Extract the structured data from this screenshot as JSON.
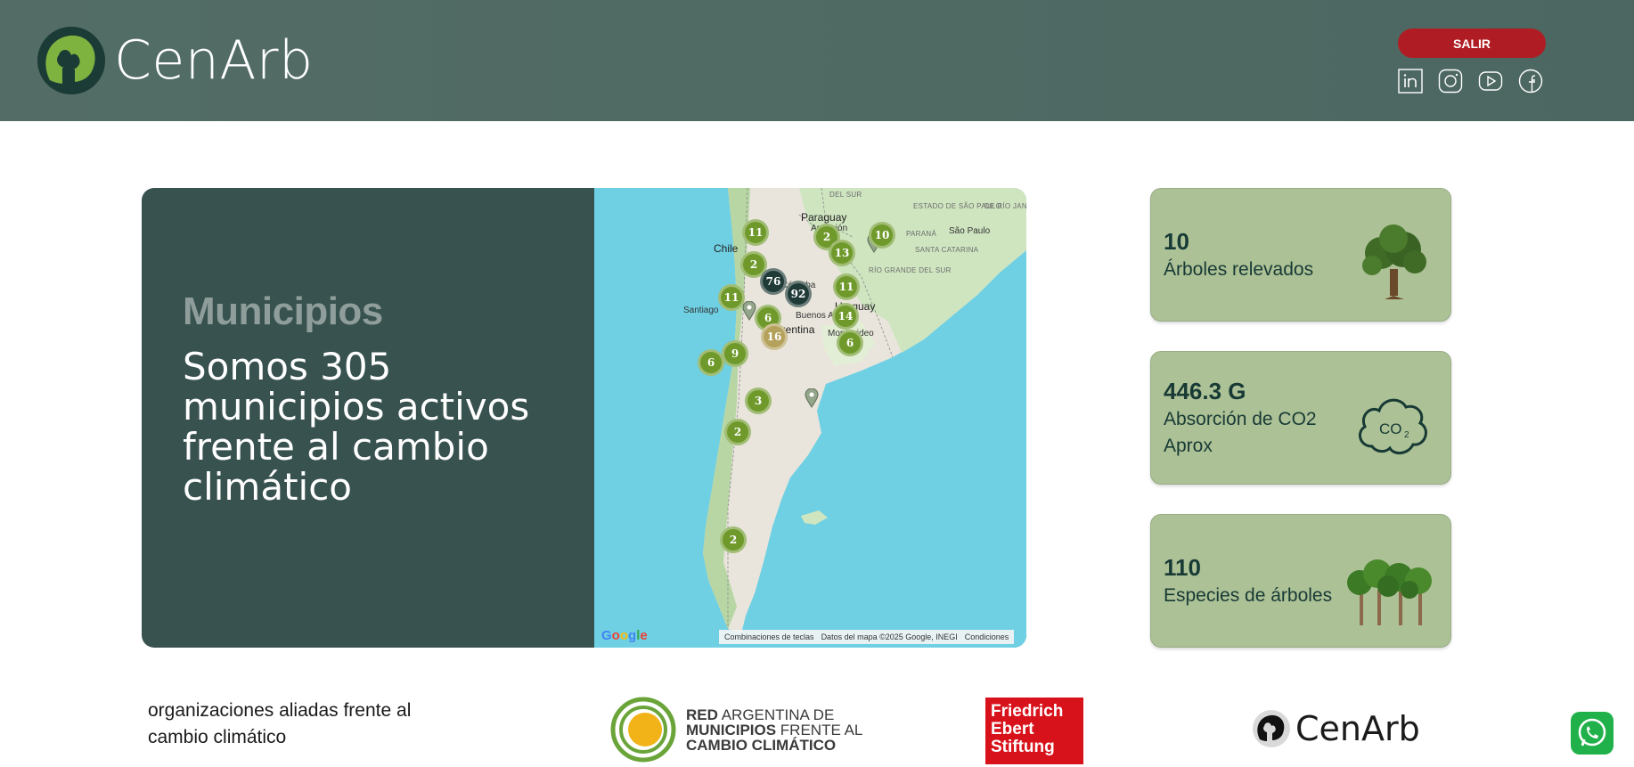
{
  "brand": {
    "name_prefix": "Cen",
    "name_suffix": "Arb",
    "logo_icon": "tree-logo-icon"
  },
  "header": {
    "logout_label": "SALIR",
    "socials": [
      "linkedin-icon",
      "instagram-icon",
      "youtube-icon",
      "facebook-icon"
    ],
    "accent": "#b01c23",
    "background": "#4f6a64"
  },
  "hero": {
    "kicker": "Municipios",
    "title": "Somos 305 municipios activos frente al cambio climático"
  },
  "map": {
    "labels": {
      "paraguay": "Paraguay",
      "asuncion": "Asunción",
      "chile": "Chile",
      "santiago": "Santiago",
      "cordoba": "Córdoba",
      "argentina": "Argentina",
      "buenos_aires": "Buenos Aires",
      "uruguay": "Uruguay",
      "montevideo": "Montevideo",
      "sao_paulo": "São Paulo",
      "estado_sp": "ESTADO DE SÃO PAULO",
      "mato_grosso": "DEL SUR",
      "parana": "PARANÁ",
      "santa_catarina": "SANTA CATARINA",
      "rio_grande": "RÍO GRANDE DEL SUR",
      "rio_janeiro": "DE RÍO JANEI"
    },
    "clusters": [
      {
        "count": "11",
        "kind": "green"
      },
      {
        "count": "2",
        "kind": "green"
      },
      {
        "count": "10",
        "kind": "green"
      },
      {
        "count": "13",
        "kind": "green"
      },
      {
        "count": "2",
        "kind": "green"
      },
      {
        "count": "76",
        "kind": "dark"
      },
      {
        "count": "92",
        "kind": "dark"
      },
      {
        "count": "11",
        "kind": "green"
      },
      {
        "count": "11",
        "kind": "green"
      },
      {
        "count": "6",
        "kind": "green"
      },
      {
        "count": "14",
        "kind": "green"
      },
      {
        "count": "16",
        "kind": "gold"
      },
      {
        "count": "6",
        "kind": "green"
      },
      {
        "count": "9",
        "kind": "green"
      },
      {
        "count": "6",
        "kind": "green"
      },
      {
        "count": "3",
        "kind": "green"
      },
      {
        "count": "2",
        "kind": "green"
      },
      {
        "count": "2",
        "kind": "green"
      }
    ],
    "google": "Google",
    "attribution": {
      "shortcuts": "Combinaciones de teclas",
      "data": "Datos del mapa ©2025 Google, INEGI",
      "terms": "Condiciones"
    }
  },
  "stats": [
    {
      "value": "10",
      "label": "Árboles relevados",
      "icon": "tree-icon"
    },
    {
      "value": "446.3 G",
      "label": "Absorción de CO2 Aprox",
      "icon": "co2-cloud-icon"
    },
    {
      "value": "110",
      "label": "Especies de árboles",
      "icon": "forest-icon"
    }
  ],
  "footer": {
    "allies_text": "organizaciones aliadas frente al cambio climático",
    "red_bold": "RED",
    "red_rest1": "ARGENTINA DE",
    "red_bold2": "MUNICIPIOS",
    "red_rest2": "FRENTE AL",
    "red_bold3": "CAMBIO CLIMÁTICO",
    "fes_lines": [
      "Friedrich",
      "Ebert",
      "Stiftung"
    ],
    "cenarb_prefix": "Cen",
    "cenarb_suffix": "Arb"
  },
  "whatsapp_icon": "whatsapp-icon"
}
